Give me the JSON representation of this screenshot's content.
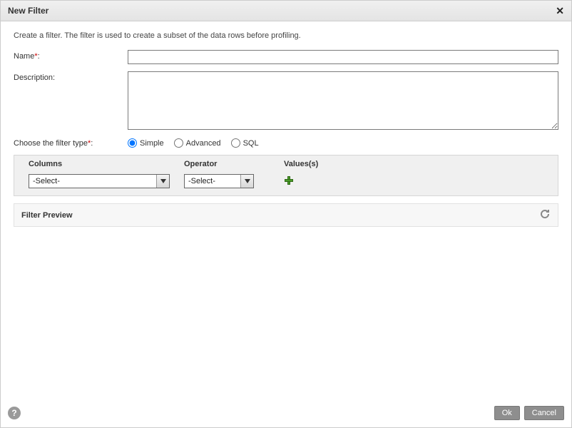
{
  "dialog_title": "New Filter",
  "intro_text": "Create a filter. The filter is used to create a subset of the data rows before profiling.",
  "fields": {
    "name_label": "Name",
    "name_value": "",
    "description_label": "Description:",
    "description_value": "",
    "filter_type_label": "Choose the filter type",
    "filter_types": {
      "simple": "Simple",
      "advanced": "Advanced",
      "sql": "SQL",
      "selected": "simple"
    }
  },
  "grid": {
    "headers": {
      "columns": "Columns",
      "operator": "Operator",
      "values": "Values(s)"
    },
    "row": {
      "columns_selected": "-Select-",
      "operator_selected": "-Select-"
    }
  },
  "preview": {
    "title": "Filter Preview"
  },
  "buttons": {
    "ok": "Ok",
    "cancel": "Cancel"
  }
}
